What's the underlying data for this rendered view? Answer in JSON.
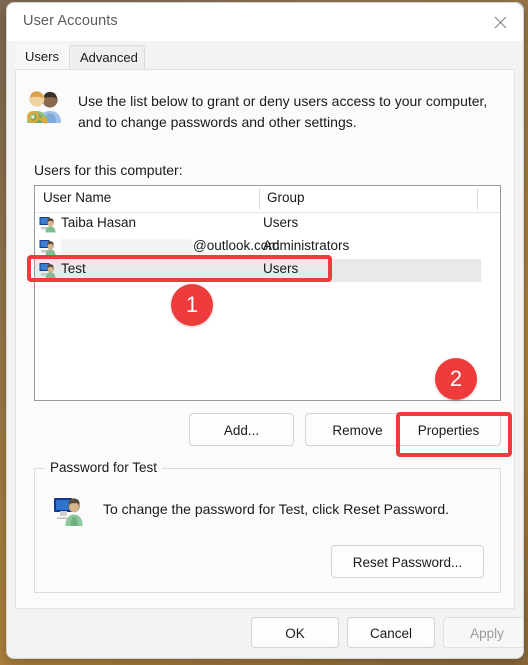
{
  "window": {
    "title": "User Accounts",
    "close_icon": "close-icon"
  },
  "tabs": [
    {
      "label": "Users",
      "selected": true
    },
    {
      "label": "Advanced",
      "selected": false
    }
  ],
  "intro": {
    "icon": "users-key-icon",
    "text": "Use the list below to grant or deny users access to your computer, and to change passwords and other settings."
  },
  "list": {
    "label": "Users for this computer:",
    "columns": [
      "User Name",
      "Group"
    ],
    "rows": [
      {
        "icon": "user-account-icon",
        "name": "Taiba Hasan",
        "group": "Users",
        "selected": false,
        "redacted": false
      },
      {
        "icon": "user-account-icon",
        "name": "",
        "name_suffix": "@outlook.com",
        "group": "Administrators",
        "selected": false,
        "redacted": true
      },
      {
        "icon": "user-account-icon",
        "name": "Test",
        "group": "Users",
        "selected": true,
        "redacted": false
      }
    ]
  },
  "list_actions": {
    "add": "Add...",
    "remove": "Remove",
    "properties": "Properties"
  },
  "password_group": {
    "title": "Password for Test",
    "icon": "user-monitor-icon",
    "text": "To change the password for Test, click Reset Password.",
    "reset_button": "Reset Password..."
  },
  "footer": {
    "ok": "OK",
    "cancel": "Cancel",
    "apply": "Apply",
    "apply_disabled": true
  },
  "annotations": {
    "badge_1": "1",
    "badge_2": "2",
    "color": "#ee3b3b"
  }
}
